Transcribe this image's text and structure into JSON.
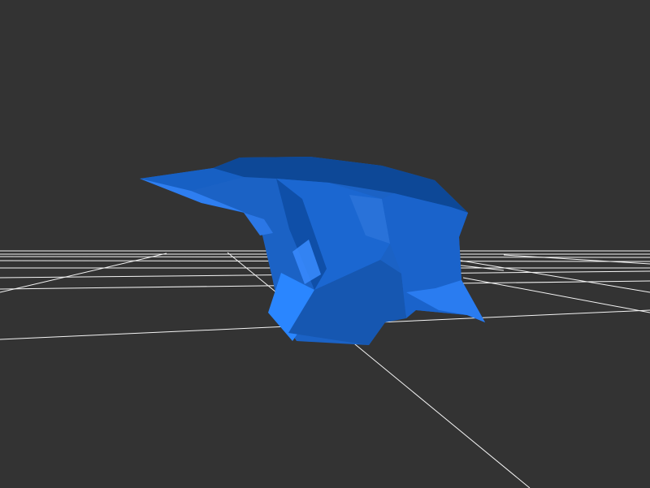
{
  "viewer": {
    "background_color": "#333333",
    "grid_color": "#ffffff",
    "model_color": "#1e6fd9",
    "model_highlight_color": "#3a8cff",
    "model_shadow_color": "#0a3f86"
  }
}
